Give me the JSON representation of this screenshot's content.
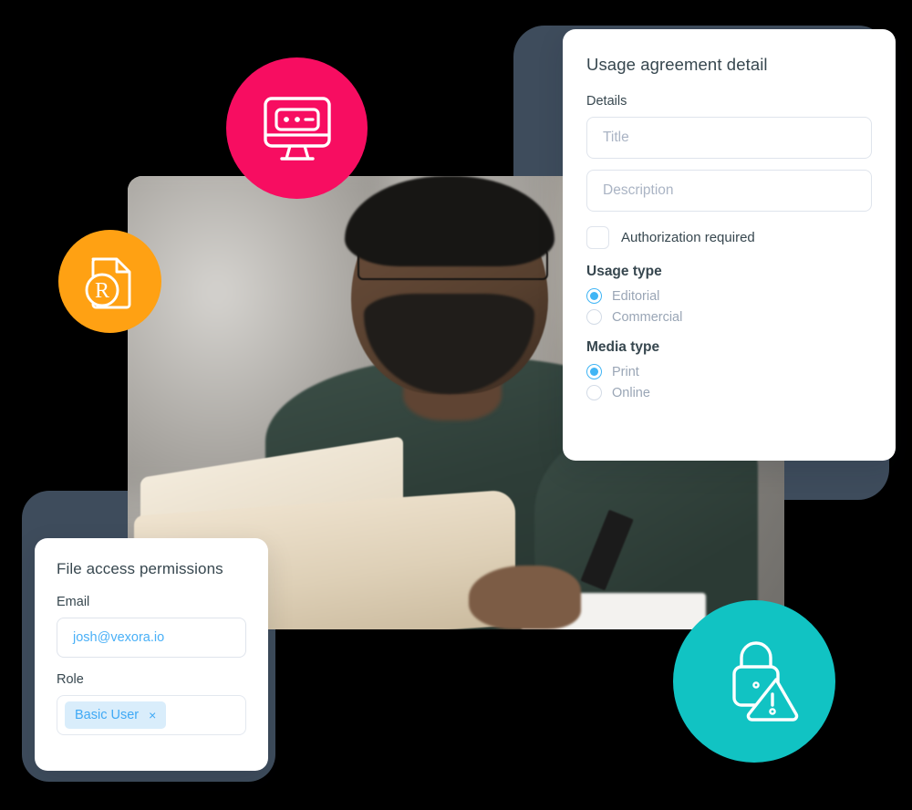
{
  "theme": {
    "accent_blue": "#40b5f5",
    "slate_card": "#3E4C5C",
    "pink_circle": "#f70d61",
    "orange_circle": "#ffa113",
    "teal_circle": "#11c3c3",
    "chip_bg": "#d9edfb",
    "text_dark": "#37474f",
    "placeholder": "#aab4c4"
  },
  "usage_panel": {
    "title": "Usage agreement detail",
    "details_label": "Details",
    "title_input": {
      "value": "",
      "placeholder": "Title"
    },
    "description_input": {
      "value": "",
      "placeholder": "Description"
    },
    "authorization": {
      "label": "Authorization required",
      "checked": false
    },
    "usage_type": {
      "label": "Usage type",
      "options": [
        {
          "label": "Editorial",
          "selected": true
        },
        {
          "label": "Commercial",
          "selected": false
        }
      ]
    },
    "media_type": {
      "label": "Media type",
      "options": [
        {
          "label": "Print",
          "selected": true
        },
        {
          "label": "Online",
          "selected": false
        }
      ]
    }
  },
  "permissions_panel": {
    "title": "File access permissions",
    "email_label": "Email",
    "email_input": {
      "value": "josh@vexora.io",
      "placeholder": "Email"
    },
    "role_label": "Role",
    "role_chip": {
      "label": "Basic User",
      "remove": "×"
    }
  },
  "icons": {
    "monitor": "monitor-icon",
    "document_registered": "document-registered-icon",
    "lock_warning": "lock-warning-icon"
  },
  "photo": {
    "alt": "man-at-laptop-photo"
  }
}
